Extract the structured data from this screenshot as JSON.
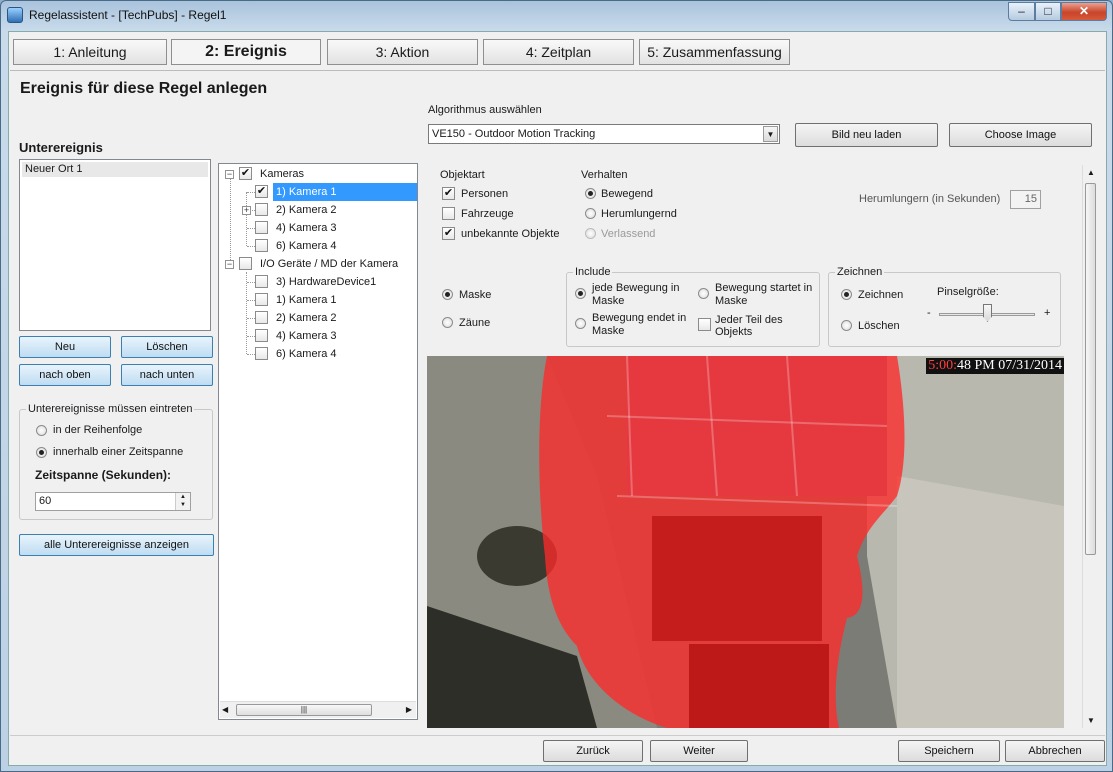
{
  "window": {
    "title": "Regelassistent - [TechPubs] - Regel1",
    "minimize_glyph": "–",
    "maximize_glyph": "□",
    "close_glyph": "✕"
  },
  "tabs": [
    {
      "label": "1: Anleitung",
      "active": false
    },
    {
      "label": "2: Ereignis",
      "active": true
    },
    {
      "label": "3: Aktion",
      "active": false
    },
    {
      "label": "4: Zeitplan",
      "active": false
    },
    {
      "label": "5: Zusammenfassung",
      "active": false
    }
  ],
  "page_heading": "Ereignis für diese Regel anlegen",
  "subevents": {
    "title": "Unterereignis",
    "items": [
      "Neuer Ort 1"
    ],
    "new_label": "Neu",
    "delete_label": "Löschen",
    "up_label": "nach oben",
    "down_label": "nach unten",
    "group_title": "Unterereignisse müssen eintreten",
    "order_label": "in der Reihenfolge",
    "timespan_option_label": "innerhalb einer Zeitspanne",
    "selected_mode": "timespan",
    "timespan_label": "Zeitspanne (Sekunden):",
    "timespan_value": "60",
    "show_all_label": "alle Unterereignisse anzeigen"
  },
  "tree": {
    "cameras_label": "Kameras",
    "cameras": [
      {
        "label": "1) Kamera 1",
        "checked": true,
        "selected": true,
        "expandable": false
      },
      {
        "label": "2) Kamera 2",
        "checked": false,
        "selected": false,
        "expandable": true
      },
      {
        "label": "4) Kamera 3",
        "checked": false,
        "selected": false,
        "expandable": false
      },
      {
        "label": "6) Kamera 4",
        "checked": false,
        "selected": false,
        "expandable": false
      }
    ],
    "io_label": "I/O Geräte / MD der Kamera",
    "io_devices": [
      {
        "label": "3) HardwareDevice1"
      },
      {
        "label": "1) Kamera 1"
      },
      {
        "label": "2) Kamera 2"
      },
      {
        "label": "4) Kamera 3"
      },
      {
        "label": "6) Kamera 4"
      }
    ],
    "scroll_grip": "|||"
  },
  "algorithm": {
    "label": "Algorithmus auswählen",
    "selected": "VE150 - Outdoor Motion Tracking",
    "reload_label": "Bild neu laden",
    "choose_label": "Choose Image"
  },
  "object_type": {
    "title": "Objektart",
    "persons_label": "Personen",
    "persons_checked": true,
    "vehicles_label": "Fahrzeuge",
    "vehicles_checked": false,
    "unknown_label": "unbekannte Objekte",
    "unknown_checked": true
  },
  "behavior": {
    "title": "Verhalten",
    "moving_label": "Bewegend",
    "loitering_label": "Herumlungernd",
    "leaving_label": "Verlassend",
    "selected": "moving"
  },
  "loiter": {
    "label": "Herumlungern (in Sekunden)",
    "value": "15"
  },
  "mode": {
    "mask_label": "Maske",
    "fence_label": "Zäune",
    "selected": "mask"
  },
  "include": {
    "title": "Include",
    "any_motion_label": "jede Bewegung in Maske",
    "motion_ends_label": "Bewegung endet in Maske",
    "motion_starts_label": "Bewegung startet in Maske",
    "any_part_label": "Jeder Teil des Objekts",
    "selected": "any_motion",
    "any_part_checked": false
  },
  "draw": {
    "title": "Zeichnen",
    "draw_label": "Zeichnen",
    "erase_label": "Löschen",
    "selected": "draw",
    "brush_label": "Pinselgröße:",
    "minus": "-",
    "plus": "+",
    "brush_level": 0.5
  },
  "video": {
    "time_hl": "5:00:",
    "time_rest": "48 PM 07/31/2014",
    "mask_color": "#ff2a2a"
  },
  "footer": {
    "back_label": "Zurück",
    "next_label": "Weiter",
    "save_label": "Speichern",
    "cancel_label": "Abbrechen"
  },
  "colors": {
    "selection": "#3399ff",
    "mask": "#ff2a2a"
  }
}
